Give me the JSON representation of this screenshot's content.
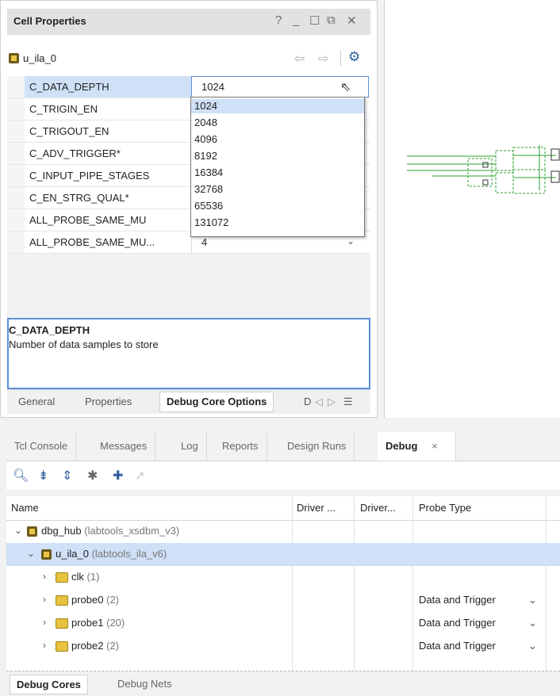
{
  "cell_properties": {
    "title": "Cell Properties",
    "window_buttons": [
      "?",
      "_",
      "☐",
      "⧉",
      "✕"
    ],
    "object_name": "u_ila_0",
    "properties": [
      {
        "name": "C_DATA_DEPTH",
        "value": "1024"
      },
      {
        "name": "C_TRIGIN_EN",
        "value": ""
      },
      {
        "name": "C_TRIGOUT_EN",
        "value": ""
      },
      {
        "name": "C_ADV_TRIGGER*",
        "value": ""
      },
      {
        "name": "C_INPUT_PIPE_STAGES",
        "value": ""
      },
      {
        "name": "C_EN_STRG_QUAL*",
        "value": ""
      },
      {
        "name": "ALL_PROBE_SAME_MU",
        "value": ""
      },
      {
        "name": "ALL_PROBE_SAME_MU...",
        "value": "4"
      }
    ],
    "dropdown_options": [
      "1024",
      "2048",
      "4096",
      "8192",
      "16384",
      "32768",
      "65536",
      "131072"
    ],
    "dropdown_selected": "1024",
    "description_title": "C_DATA_DEPTH",
    "description_text": "Number of data samples to store",
    "tabs": [
      "General",
      "Properties",
      "Debug Core Options",
      "D"
    ],
    "active_tab": "Debug Core Options"
  },
  "bottom_panel": {
    "tabs": [
      "Tcl Console",
      "Messages",
      "Log",
      "Reports",
      "Design Runs",
      "Debug"
    ],
    "active_tab": "Debug",
    "close_icon": "×",
    "columns": [
      "Name",
      "Driver ...",
      "Driver...",
      "Probe Type"
    ],
    "rows": [
      {
        "name": "dbg_hub",
        "extra": "(labtools_xsdbm_v3)",
        "probe_type": ""
      },
      {
        "name": "u_ila_0",
        "extra": "(labtools_ila_v6)",
        "probe_type": ""
      },
      {
        "name": "clk",
        "extra": "(1)",
        "probe_type": ""
      },
      {
        "name": "probe0",
        "extra": "(2)",
        "probe_type": "Data and Trigger"
      },
      {
        "name": "probe1",
        "extra": "(20)",
        "probe_type": "Data and Trigger"
      },
      {
        "name": "probe2",
        "extra": "(2)",
        "probe_type": "Data and Trigger"
      }
    ],
    "bottom_tabs": [
      "Debug Cores",
      "Debug Nets"
    ],
    "active_bottom_tab": "Debug Cores"
  }
}
